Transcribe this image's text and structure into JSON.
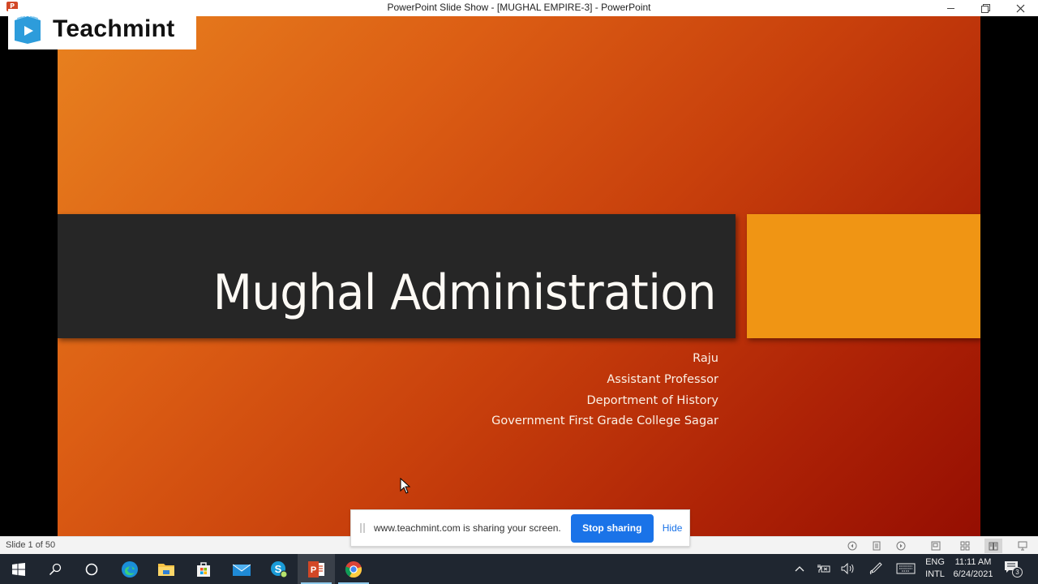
{
  "window": {
    "title": "PowerPoint Slide Show - [MUGHAL EMPIRE-3] - PowerPoint",
    "app_icon_label": "P",
    "controls": [
      "minimize",
      "restore",
      "close"
    ]
  },
  "watermark": {
    "brand": "Teachmint",
    "logo_color": "#2d9cdb"
  },
  "slide": {
    "title": "Mughal Administration",
    "subtitle_lines": [
      "Raju",
      "Assistant Professor",
      "Deportment of History",
      "Government First Grade College Sagar"
    ],
    "colors": {
      "band": "#262626",
      "accent": "#f09514",
      "gradient_start": "#e8821f",
      "gradient_end": "#950e02"
    }
  },
  "share_bar": {
    "message": "www.teachmint.com is sharing your screen.",
    "stop_label": "Stop sharing",
    "hide_label": "Hide",
    "accent": "#1a73e8"
  },
  "statusbar": {
    "slide_indicator": "Slide 1 of 50",
    "icons": [
      "previous-icon",
      "slide-menu-icon",
      "next-icon",
      "normal-view-icon",
      "slide-sorter-icon",
      "reading-view-icon",
      "slideshow-icon"
    ],
    "active_view": "reading-view-icon"
  },
  "taskbar": {
    "apps": [
      "start",
      "search",
      "cortana",
      "edge",
      "file-explorer",
      "store",
      "mail",
      "skype",
      "powerpoint",
      "chrome"
    ],
    "active_app": "powerpoint",
    "language_line1": "ENG",
    "language_line2": "INTL",
    "time": "11:11 AM",
    "date": "6/24/2021",
    "notification_count": "3"
  }
}
